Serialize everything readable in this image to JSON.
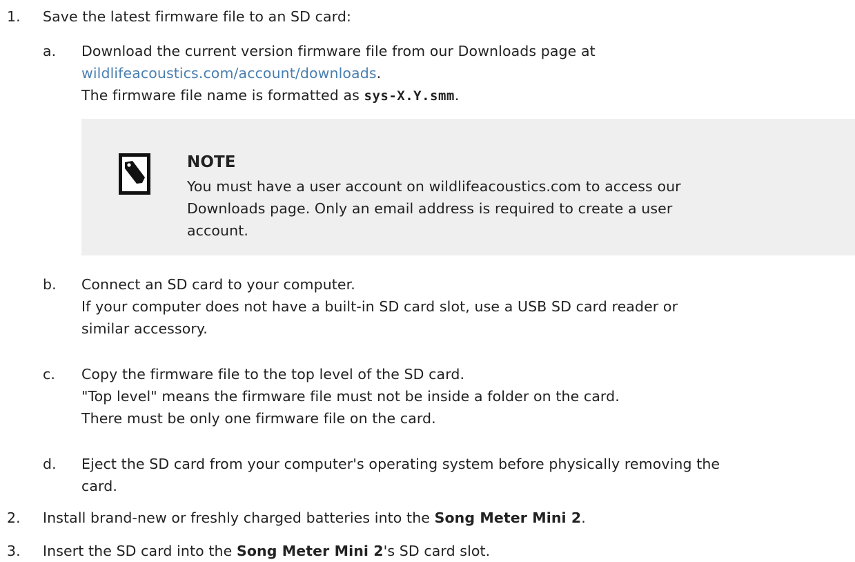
{
  "steps": [
    {
      "num": "1.",
      "text": "Save the latest firmware file to an SD card:"
    },
    {
      "num": "2.",
      "before": "Install brand-new or freshly charged batteries into the ",
      "product": "Song Meter Mini 2",
      "after": "."
    },
    {
      "num": "3.",
      "before": "Insert the SD card into the ",
      "product": "Song Meter Mini 2",
      "after": "'s SD card slot."
    }
  ],
  "substeps": {
    "a": {
      "letter": "a.",
      "line1": "Download the current version firmware file from our Downloads page at",
      "link": "wildlifeacoustics.com/account/downloads",
      "link_after": ".",
      "line3_before": "The firmware file name is formatted as ",
      "code": "sys-X.Y.smm",
      "line3_after": "."
    },
    "b": {
      "letter": "b.",
      "line1": "Connect an SD card to your computer.",
      "line2": "If your computer does not have a built-in SD card slot, use a USB SD card reader or",
      "line3": "similar accessory."
    },
    "c": {
      "letter": "c.",
      "line1": "Copy the firmware file to the top level of the SD card.",
      "line2": "\"Top level\" means the firmware file must not be inside a folder on the card.",
      "line3": "There must be only one firmware file on the card."
    },
    "d": {
      "letter": "d.",
      "line1": "Eject the SD card from your computer's operating system before physically removing the",
      "line2": "card."
    }
  },
  "note": {
    "icon": "note-tag-icon",
    "title": "NOTE",
    "line1": "You must have a user account on wildlifeacoustics.com to access our",
    "line2": "Downloads page. Only an email address is required to create a user",
    "line3": "account."
  },
  "colors": {
    "link": "#4a7fb0",
    "note_background": "#efefef",
    "text": "#222222"
  }
}
